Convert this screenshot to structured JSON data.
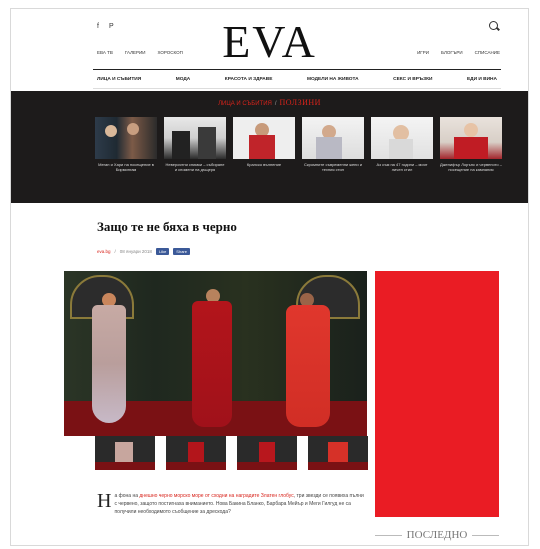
{
  "site": {
    "logo": "EVA",
    "social": [
      "f",
      "P"
    ],
    "left_links": [
      "ЕВА ТВ",
      "ГАЛЕРИИ",
      "ХОРОСКОП"
    ],
    "right_links": [
      "ИГРИ",
      "БЛОГЪРИ",
      "СПИСАНИЕ"
    ]
  },
  "nav": [
    "ЛИЦА И СЪБИТИЯ",
    "МОДА",
    "КРАСОТА И ЗДРАВЕ",
    "МОДЕЛИ НА ЖИВОТА",
    "СЕКС И ВРЪЗКИ",
    "ЕДИ И ВИНА"
  ],
  "band": {
    "label": "ЛИЦА И СЪБИТИЯ",
    "title": "ПОЛЗИНИ",
    "cards": [
      {
        "caption": "Меган и Хари на посещение в Бирмингам"
      },
      {
        "caption": "Невероятни снимки – събиране и спомени на дъщеря"
      },
      {
        "caption": "Кралско вълнение"
      },
      {
        "caption": "Скромните съвременни жени и техния стил"
      },
      {
        "caption": "Аз съм на 47 години – моят личен стил"
      },
      {
        "caption": "Дженифър Лорънс и червеното – посещение на кампания"
      }
    ]
  },
  "article": {
    "title": "Защо те не бяха в черно",
    "author": "eva.bg",
    "date": "08 януари 2018",
    "share_like": "Like",
    "share_share": "Share",
    "dropcap": "Н",
    "body_pre": "а фона на ",
    "body_link": "днешно черно морско море от сходни на наградите Златен глобус",
    "body_post": ", три звезди се появиха пълни с червено, защото постигнаха вниманието. Нова Бакина Бланко, Барбара Мейър и Меги Гилгуд не са получили необходимото съобщение за дрескода?",
    "sidebar_heading": "ПОСЛЕДНО"
  }
}
